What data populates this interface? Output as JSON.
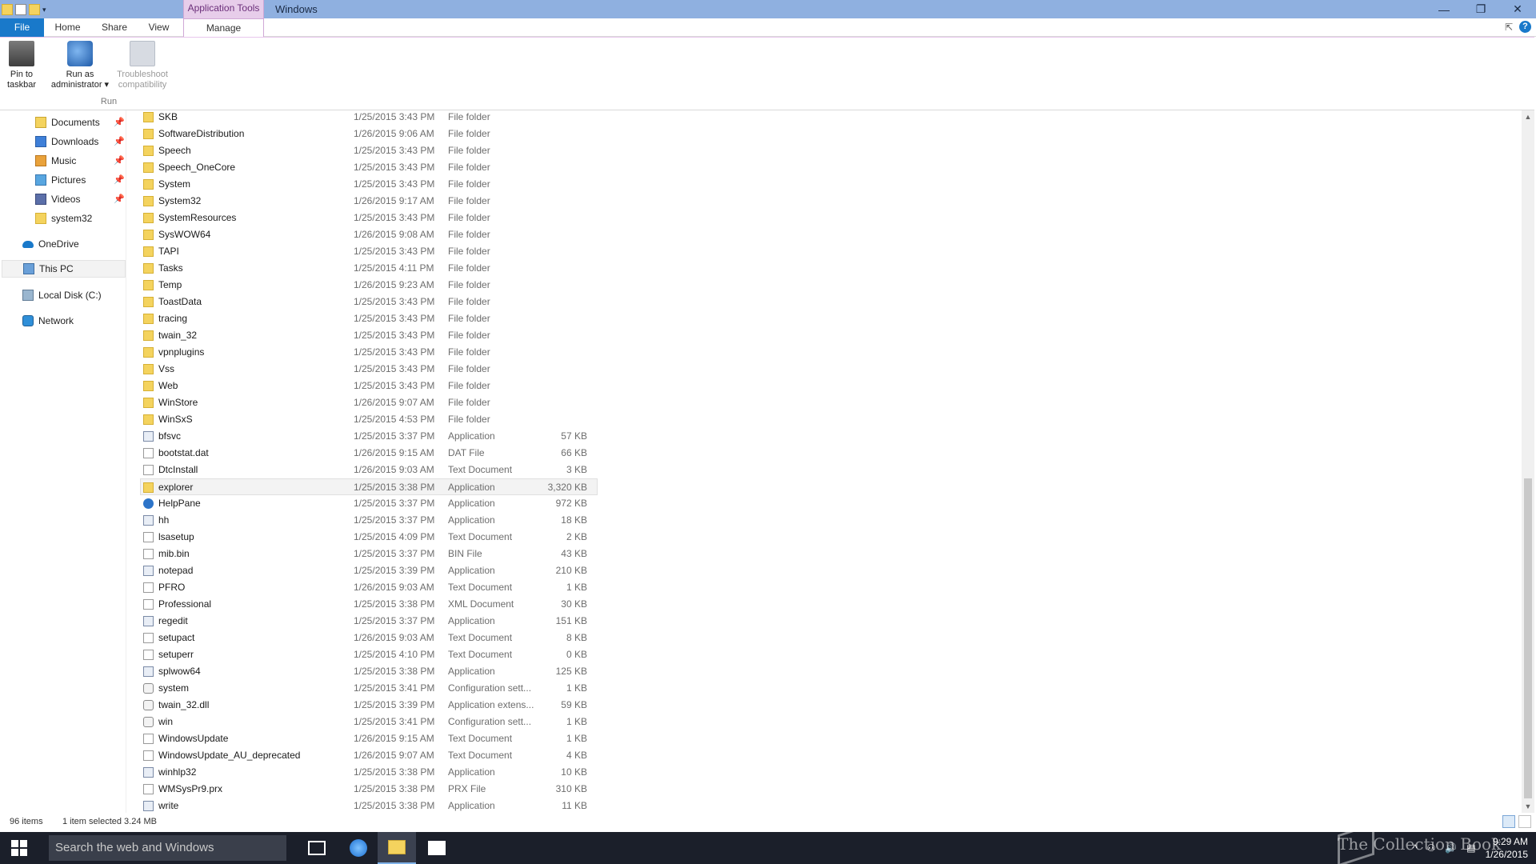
{
  "titlebar": {
    "context_tab": "Application Tools",
    "title": "Windows",
    "minimize": "—",
    "restore": "❐",
    "close": "✕"
  },
  "tabs": {
    "file": "File",
    "home": "Home",
    "share": "Share",
    "view": "View",
    "manage": "Manage"
  },
  "ribbon": {
    "pin_to_taskbar": "Pin to taskbar",
    "pin_to_taskbar_l1": "Pin to",
    "pin_to_taskbar_l2": "taskbar",
    "run_as_admin_l1": "Run as",
    "run_as_admin_l2": "administrator ▾",
    "troubleshoot_l1": "Troubleshoot",
    "troubleshoot_l2": "compatibility",
    "group_label": "Run"
  },
  "nav": {
    "documents": "Documents",
    "downloads": "Downloads",
    "music": "Music",
    "pictures": "Pictures",
    "videos": "Videos",
    "system32": "system32",
    "onedrive": "OneDrive",
    "thispc": "This PC",
    "localdisk": "Local Disk (C:)",
    "network": "Network",
    "pin_glyph": "📌"
  },
  "files": [
    {
      "name": "SKB",
      "date": "1/25/2015 3:43 PM",
      "type": "File folder",
      "size": "",
      "icon": "folder"
    },
    {
      "name": "SoftwareDistribution",
      "date": "1/26/2015 9:06 AM",
      "type": "File folder",
      "size": "",
      "icon": "folder"
    },
    {
      "name": "Speech",
      "date": "1/25/2015 3:43 PM",
      "type": "File folder",
      "size": "",
      "icon": "folder"
    },
    {
      "name": "Speech_OneCore",
      "date": "1/25/2015 3:43 PM",
      "type": "File folder",
      "size": "",
      "icon": "folder"
    },
    {
      "name": "System",
      "date": "1/25/2015 3:43 PM",
      "type": "File folder",
      "size": "",
      "icon": "folder"
    },
    {
      "name": "System32",
      "date": "1/26/2015 9:17 AM",
      "type": "File folder",
      "size": "",
      "icon": "folder"
    },
    {
      "name": "SystemResources",
      "date": "1/25/2015 3:43 PM",
      "type": "File folder",
      "size": "",
      "icon": "folder"
    },
    {
      "name": "SysWOW64",
      "date": "1/26/2015 9:08 AM",
      "type": "File folder",
      "size": "",
      "icon": "folder"
    },
    {
      "name": "TAPI",
      "date": "1/25/2015 3:43 PM",
      "type": "File folder",
      "size": "",
      "icon": "folder"
    },
    {
      "name": "Tasks",
      "date": "1/25/2015 4:11 PM",
      "type": "File folder",
      "size": "",
      "icon": "folder"
    },
    {
      "name": "Temp",
      "date": "1/26/2015 9:23 AM",
      "type": "File folder",
      "size": "",
      "icon": "folder"
    },
    {
      "name": "ToastData",
      "date": "1/25/2015 3:43 PM",
      "type": "File folder",
      "size": "",
      "icon": "folder"
    },
    {
      "name": "tracing",
      "date": "1/25/2015 3:43 PM",
      "type": "File folder",
      "size": "",
      "icon": "folder"
    },
    {
      "name": "twain_32",
      "date": "1/25/2015 3:43 PM",
      "type": "File folder",
      "size": "",
      "icon": "folder"
    },
    {
      "name": "vpnplugins",
      "date": "1/25/2015 3:43 PM",
      "type": "File folder",
      "size": "",
      "icon": "folder"
    },
    {
      "name": "Vss",
      "date": "1/25/2015 3:43 PM",
      "type": "File folder",
      "size": "",
      "icon": "folder"
    },
    {
      "name": "Web",
      "date": "1/25/2015 3:43 PM",
      "type": "File folder",
      "size": "",
      "icon": "folder"
    },
    {
      "name": "WinStore",
      "date": "1/26/2015 9:07 AM",
      "type": "File folder",
      "size": "",
      "icon": "folder"
    },
    {
      "name": "WinSxS",
      "date": "1/25/2015 4:53 PM",
      "type": "File folder",
      "size": "",
      "icon": "folder"
    },
    {
      "name": "bfsvc",
      "date": "1/25/2015 3:37 PM",
      "type": "Application",
      "size": "57 KB",
      "icon": "app"
    },
    {
      "name": "bootstat.dat",
      "date": "1/26/2015 9:15 AM",
      "type": "DAT File",
      "size": "66 KB",
      "icon": "doc"
    },
    {
      "name": "DtcInstall",
      "date": "1/26/2015 9:03 AM",
      "type": "Text Document",
      "size": "3 KB",
      "icon": "doc"
    },
    {
      "name": "explorer",
      "date": "1/25/2015 3:38 PM",
      "type": "Application",
      "size": "3,320 KB",
      "icon": "folder",
      "selected": true
    },
    {
      "name": "HelpPane",
      "date": "1/25/2015 3:37 PM",
      "type": "Application",
      "size": "972 KB",
      "icon": "help"
    },
    {
      "name": "hh",
      "date": "1/25/2015 3:37 PM",
      "type": "Application",
      "size": "18 KB",
      "icon": "app"
    },
    {
      "name": "lsasetup",
      "date": "1/25/2015 4:09 PM",
      "type": "Text Document",
      "size": "2 KB",
      "icon": "doc"
    },
    {
      "name": "mib.bin",
      "date": "1/25/2015 3:37 PM",
      "type": "BIN File",
      "size": "43 KB",
      "icon": "doc"
    },
    {
      "name": "notepad",
      "date": "1/25/2015 3:39 PM",
      "type": "Application",
      "size": "210 KB",
      "icon": "app"
    },
    {
      "name": "PFRO",
      "date": "1/26/2015 9:03 AM",
      "type": "Text Document",
      "size": "1 KB",
      "icon": "doc"
    },
    {
      "name": "Professional",
      "date": "1/25/2015 3:38 PM",
      "type": "XML Document",
      "size": "30 KB",
      "icon": "doc"
    },
    {
      "name": "regedit",
      "date": "1/25/2015 3:37 PM",
      "type": "Application",
      "size": "151 KB",
      "icon": "app"
    },
    {
      "name": "setupact",
      "date": "1/26/2015 9:03 AM",
      "type": "Text Document",
      "size": "8 KB",
      "icon": "doc"
    },
    {
      "name": "setuperr",
      "date": "1/25/2015 4:10 PM",
      "type": "Text Document",
      "size": "0 KB",
      "icon": "doc"
    },
    {
      "name": "splwow64",
      "date": "1/25/2015 3:38 PM",
      "type": "Application",
      "size": "125 KB",
      "icon": "app"
    },
    {
      "name": "system",
      "date": "1/25/2015 3:41 PM",
      "type": "Configuration sett...",
      "size": "1 KB",
      "icon": "cfg"
    },
    {
      "name": "twain_32.dll",
      "date": "1/25/2015 3:39 PM",
      "type": "Application extens...",
      "size": "59 KB",
      "icon": "cfg"
    },
    {
      "name": "win",
      "date": "1/25/2015 3:41 PM",
      "type": "Configuration sett...",
      "size": "1 KB",
      "icon": "cfg"
    },
    {
      "name": "WindowsUpdate",
      "date": "1/26/2015 9:15 AM",
      "type": "Text Document",
      "size": "1 KB",
      "icon": "doc"
    },
    {
      "name": "WindowsUpdate_AU_deprecated",
      "date": "1/26/2015 9:07 AM",
      "type": "Text Document",
      "size": "4 KB",
      "icon": "doc"
    },
    {
      "name": "winhlp32",
      "date": "1/25/2015 3:38 PM",
      "type": "Application",
      "size": "10 KB",
      "icon": "app"
    },
    {
      "name": "WMSysPr9.prx",
      "date": "1/25/2015 3:38 PM",
      "type": "PRX File",
      "size": "310 KB",
      "icon": "doc"
    },
    {
      "name": "write",
      "date": "1/25/2015 3:38 PM",
      "type": "Application",
      "size": "11 KB",
      "icon": "app"
    }
  ],
  "status": {
    "count": "96 items",
    "selection": "1 item selected  3.24 MB"
  },
  "taskbar": {
    "search_placeholder": "Search the web and Windows",
    "time": "9:29 AM",
    "date": "1/26/2015",
    "watermark": "The Collection Book"
  },
  "colors": {
    "accent": "#1979ca",
    "titlebar": "#8fb0e0",
    "context_tab": "#e7cdea",
    "taskbar": "#1b1f2a"
  }
}
